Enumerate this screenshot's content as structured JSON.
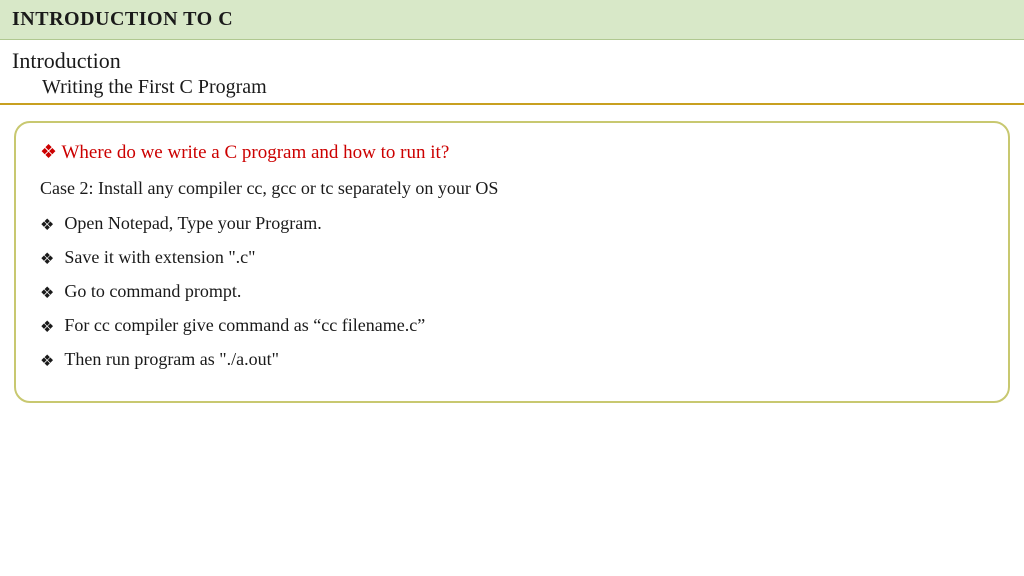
{
  "header": {
    "title": "INTRODUCTION TO C"
  },
  "breadcrumb": {
    "intro": "Introduction",
    "sub": "Writing the First C Program"
  },
  "content": {
    "question": "Where do we write a C program and how to run it?",
    "case_line": "Case 2: Install any compiler cc, gcc or tc separately on your OS",
    "bullets": [
      "Open Notepad, Type your Program.",
      "Save it with extension \".c\"",
      "Go to command prompt.",
      "For cc compiler give command as “cc filename.c”",
      "Then run program as \"./a.out\""
    ]
  }
}
